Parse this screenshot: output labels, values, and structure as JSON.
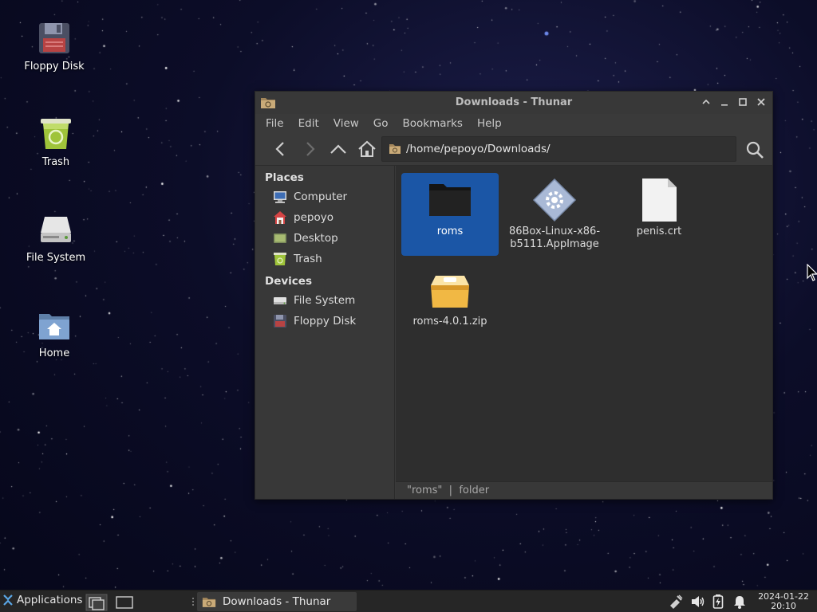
{
  "desktop": {
    "icons": [
      {
        "label": "Floppy Disk",
        "icon": "floppy-disk-icon"
      },
      {
        "label": "Trash",
        "icon": "trash-icon"
      },
      {
        "label": "File System",
        "icon": "drive-icon"
      },
      {
        "label": "Home",
        "icon": "home-folder-icon"
      }
    ]
  },
  "window": {
    "title": "Downloads - Thunar",
    "menu": [
      "File",
      "Edit",
      "View",
      "Go",
      "Bookmarks",
      "Help"
    ],
    "path": "/home/pepoyo/Downloads/",
    "sidebar": {
      "places_header": "Places",
      "places": [
        {
          "label": "Computer",
          "icon": "computer-icon"
        },
        {
          "label": "pepoyo",
          "icon": "user-home-icon"
        },
        {
          "label": "Desktop",
          "icon": "desktop-icon"
        },
        {
          "label": "Trash",
          "icon": "trash-icon"
        }
      ],
      "devices_header": "Devices",
      "devices": [
        {
          "label": "File System",
          "icon": "drive-icon"
        },
        {
          "label": "Floppy Disk",
          "icon": "floppy-disk-icon"
        }
      ]
    },
    "files": [
      {
        "line1": "roms",
        "line2": "",
        "icon": "folder-icon",
        "selected": true
      },
      {
        "line1": "86Box-Linux-x86-",
        "line2": "b5111.AppImage",
        "icon": "executable-icon",
        "selected": false
      },
      {
        "line1": "penis.crt",
        "line2": "",
        "icon": "file-icon",
        "selected": false
      },
      {
        "line1": "roms-4.0.1.zip",
        "line2": "",
        "icon": "archive-icon",
        "selected": false
      }
    ],
    "status": "\"roms\"  |  folder"
  },
  "taskbar": {
    "applications_label": "Applications",
    "task_label": "Downloads - Thunar",
    "date": "2024-01-22",
    "time": "20:10"
  },
  "colors": {
    "selection": "#1b56a6",
    "window_bg": "#3a3a3a",
    "taskbar_bg": "#262626"
  }
}
